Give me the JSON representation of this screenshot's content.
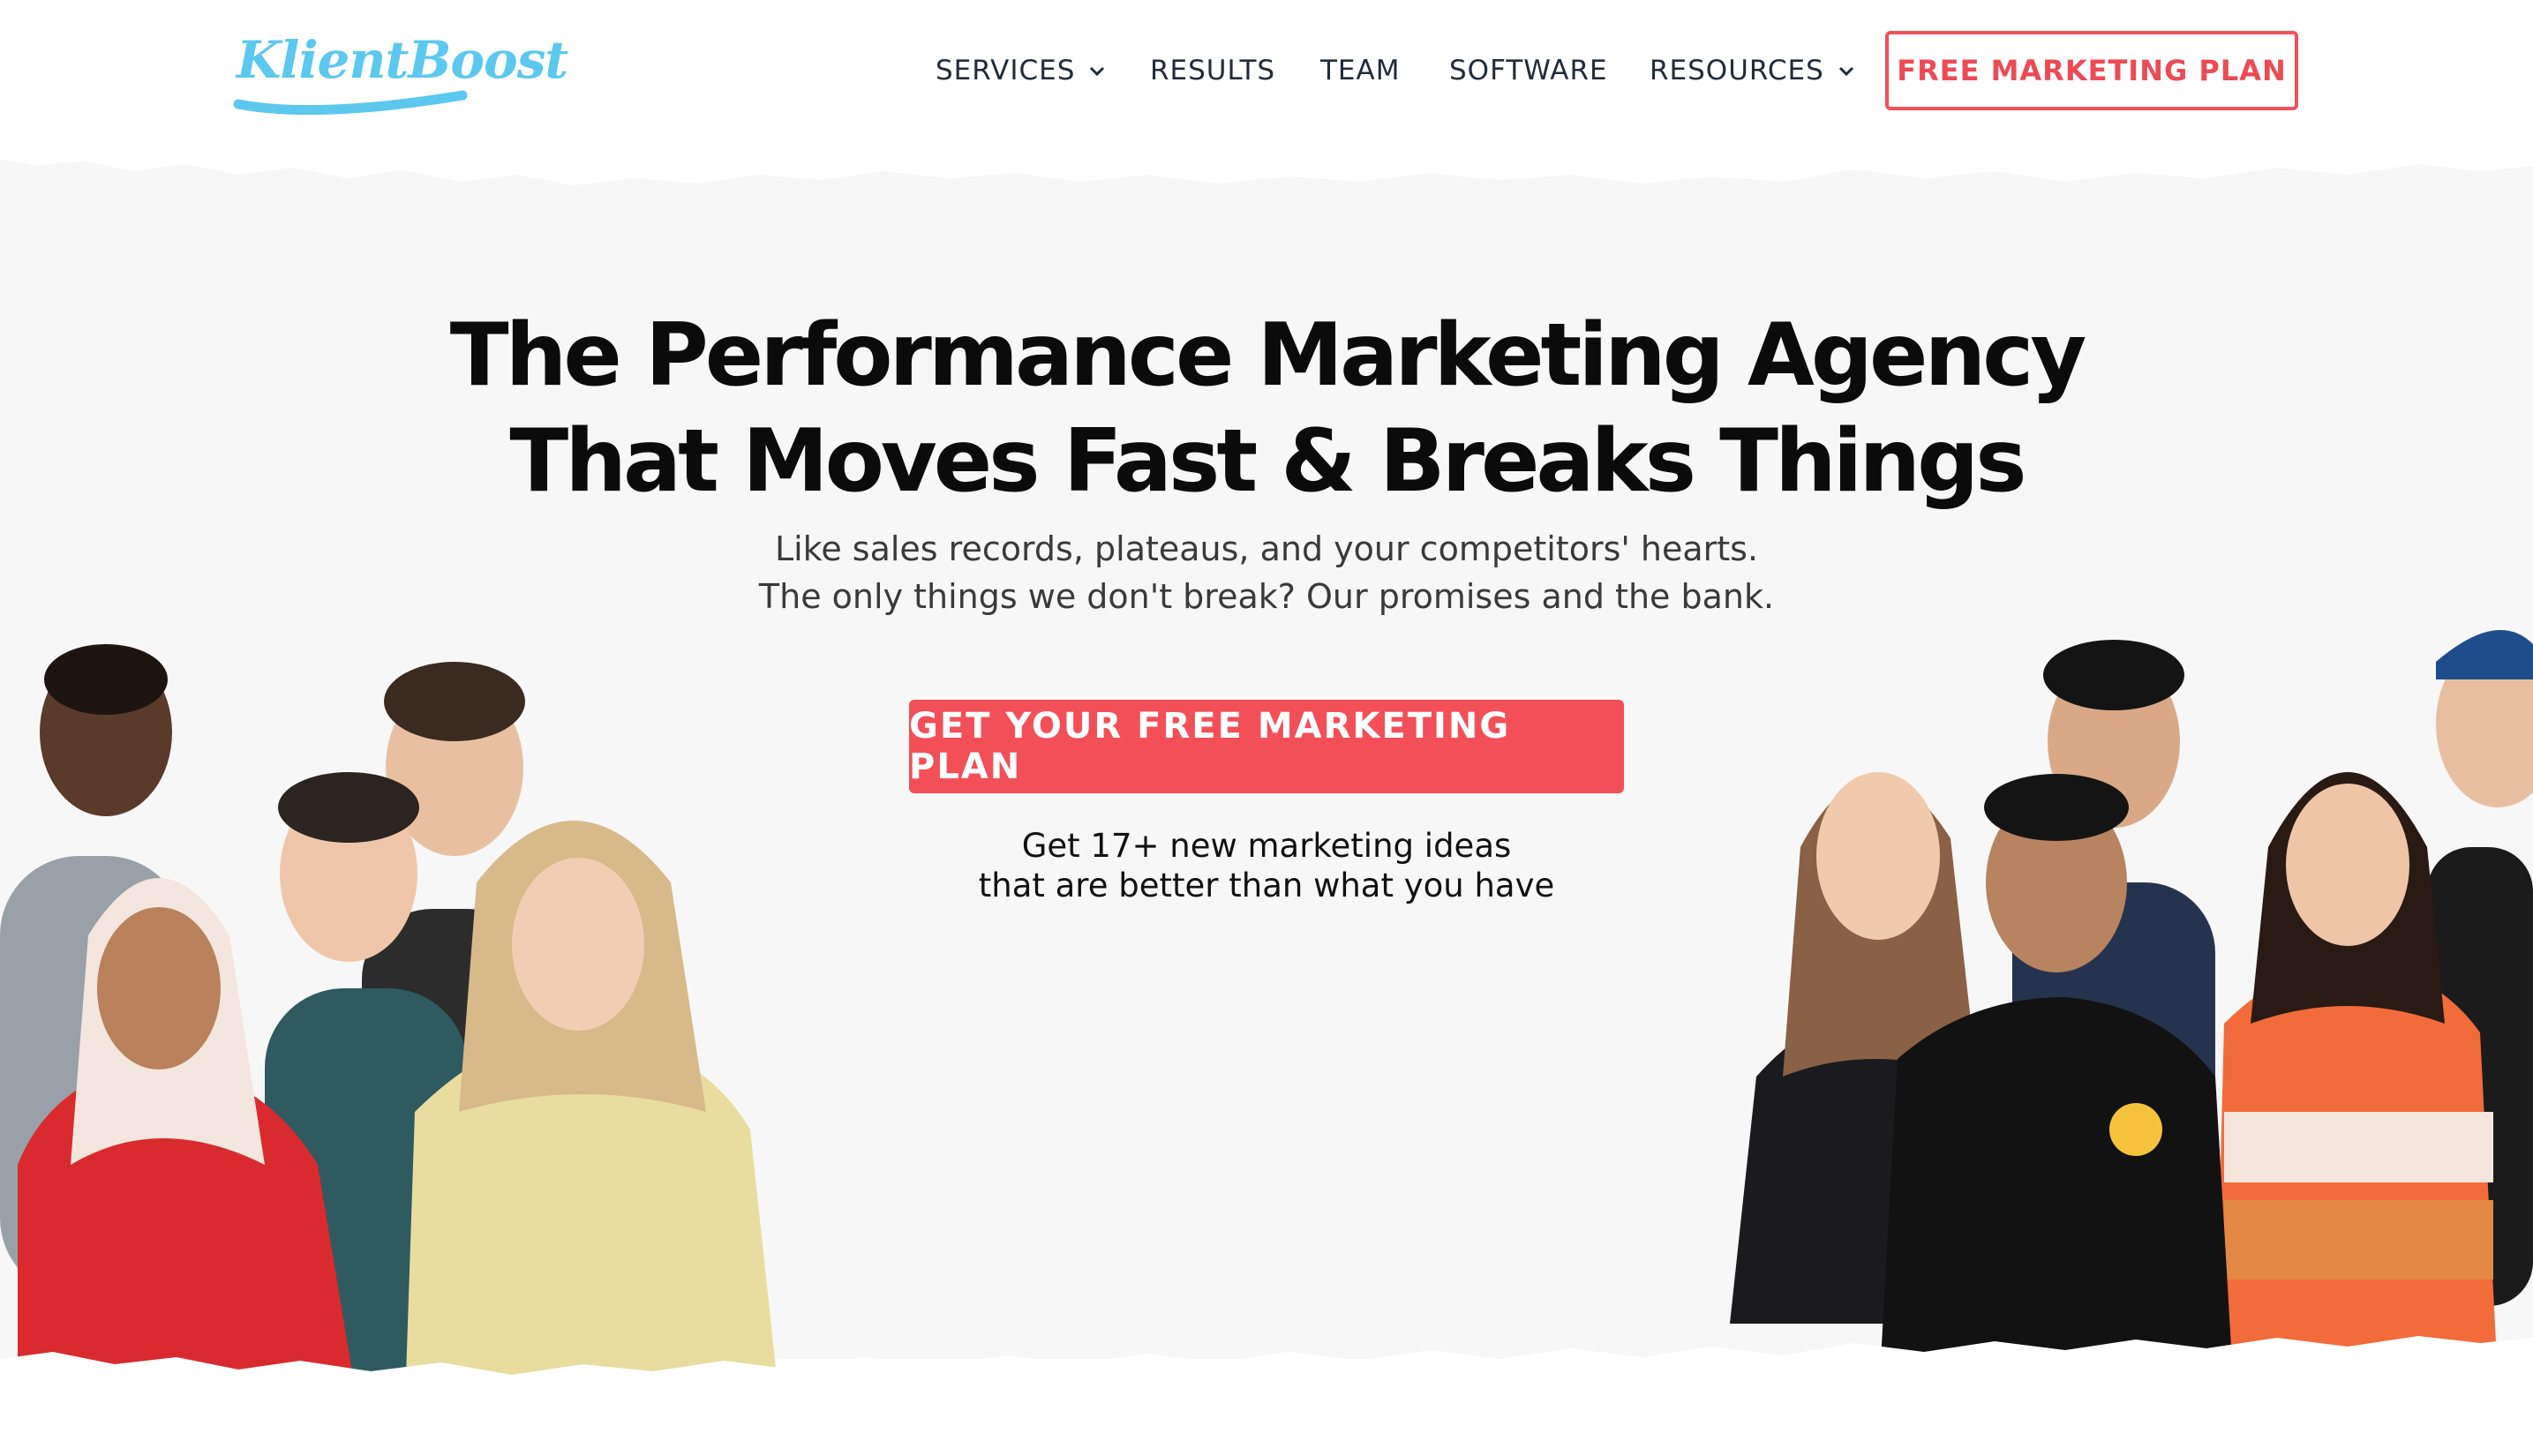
{
  "header": {
    "logo_text": "KlientBoost",
    "nav": [
      {
        "label": "SERVICES",
        "has_dropdown": true
      },
      {
        "label": "RESULTS",
        "has_dropdown": false
      },
      {
        "label": "TEAM",
        "has_dropdown": false
      },
      {
        "label": "SOFTWARE",
        "has_dropdown": false
      },
      {
        "label": "RESOURCES",
        "has_dropdown": true
      }
    ],
    "cta_label": "FREE MARKETING PLAN"
  },
  "hero": {
    "headline_line1": "The Performance Marketing Agency",
    "headline_line2": "That Moves Fast & Breaks Things",
    "subhead_line1": "Like sales records, plateaus, and your competitors' hearts.",
    "subhead_line2": "The only things we don't break? Our promises and the bank.",
    "cta_label": "GET YOUR FREE MARKETING PLAN",
    "note_line1": "Get 17+ new marketing ideas",
    "note_line2": "that are better than what you have"
  },
  "colors": {
    "accent": "#f24f58",
    "logo": "#5cc8ee",
    "nav_text": "#222b3a",
    "hero_bg": "#f7f7f7"
  },
  "icons": {
    "dropdown": "chevron-down-icon"
  }
}
